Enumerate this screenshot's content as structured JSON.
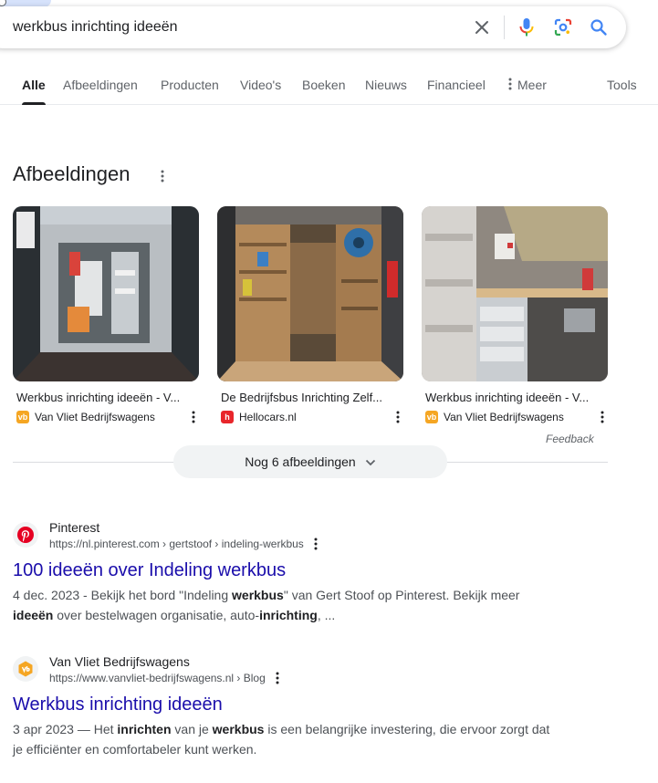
{
  "search": {
    "query": "werkbus inrichting ideeën"
  },
  "icons": {
    "clear": "close-icon",
    "voice": "microphone-icon",
    "lens": "camera-lens-icon",
    "search": "search-icon"
  },
  "colors": {
    "link": "#1a0dab",
    "snippet": "#4d5156",
    "google_blue": "#4285f4",
    "google_red": "#ea4335",
    "google_yellow": "#fbbc04",
    "google_green": "#34a853",
    "pinterest": "#e60023",
    "vanvliet": "#f5a623",
    "hellocars": "#e8262b"
  },
  "tabs": [
    {
      "label": "Alle",
      "active": true
    },
    {
      "label": "Afbeeldingen"
    },
    {
      "label": "Producten"
    },
    {
      "label": "Video's"
    },
    {
      "label": "Boeken"
    },
    {
      "label": "Nieuws"
    },
    {
      "label": "Financieel"
    },
    {
      "label": "Meer"
    },
    {
      "label": "Tools"
    }
  ],
  "images_section": {
    "title": "Afbeeldingen",
    "cards": [
      {
        "title": "Werkbus inrichting ideeën - V...",
        "source": "Van Vliet Bedrijfswagens",
        "favicon_letter": "vb"
      },
      {
        "title": "De Bedrijfsbus Inrichting Zelf...",
        "source": "Hellocars.nl",
        "favicon_letter": "h"
      },
      {
        "title": "Werkbus inrichting ideeën - V...",
        "source": "Van Vliet Bedrijfswagens",
        "favicon_letter": "vb"
      }
    ],
    "feedback": "Feedback",
    "more_label": "Nog 6 afbeeldingen"
  },
  "results": [
    {
      "site": "Pinterest",
      "url": "https://nl.pinterest.com › gertstoof › indeling-werkbus",
      "title": "100 ideeën over Indeling werkbus",
      "snippet_line1_a": "4 dec. 2023 - Bekijk het bord \"Indeling ",
      "snippet_line1_b": "werkbus",
      "snippet_line1_c": "\" van Gert Stoof op Pinterest. Bekijk meer",
      "snippet_line2_a": "ideeën",
      "snippet_line2_b": " over bestelwagen organisatie, auto-",
      "snippet_line2_c": "inrichting",
      "snippet_line2_d": ", ..."
    },
    {
      "site": "Van Vliet Bedrijfswagens",
      "url": "https://www.vanvliet-bedrijfswagens.nl › Blog",
      "title": "Werkbus inrichting ideeën",
      "snippet_line1_a": "3 apr 2023 — Het ",
      "snippet_line1_b": "inrichten",
      "snippet_line1_c": " van je ",
      "snippet_line1_d": "werkbus",
      "snippet_line1_e": " is een belangrijke investering, die ervoor zorgt dat",
      "snippet_line2": "je efficiënter en comfortabeler kunt werken."
    }
  ]
}
